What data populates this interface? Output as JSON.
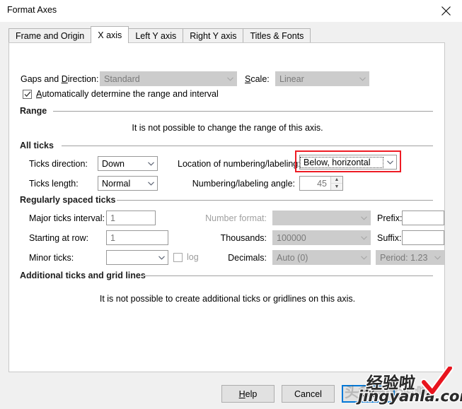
{
  "window": {
    "title": "Format Axes",
    "close_icon": "close-icon"
  },
  "tabs": [
    {
      "label": "Frame and Origin",
      "active": false
    },
    {
      "label": "X axis",
      "active": true
    },
    {
      "label": "Left Y axis",
      "active": false
    },
    {
      "label": "Right Y axis",
      "active": false
    },
    {
      "label": "Titles & Fonts",
      "active": false
    }
  ],
  "top": {
    "gaps_label": "Gaps and Direction:",
    "gaps_label_pre": "Gaps and ",
    "gaps_label_key": "D",
    "gaps_label_post": "irection:",
    "gaps_value": "Standard",
    "scale_label_pre": "",
    "scale_label_key": "S",
    "scale_label_post": "cale:",
    "scale_value": "Linear",
    "auto_range_checkbox": {
      "checked": true,
      "label_key": "A",
      "label_post": "utomatically determine the range and interval"
    }
  },
  "range_group": {
    "header": "Range",
    "message": "It is not possible to change the range of this axis."
  },
  "all_ticks_group": {
    "header": "All ticks",
    "ticks_direction_label": "Ticks direction:",
    "ticks_direction_value": "Down",
    "ticks_length_label": "Ticks length:",
    "ticks_length_value": "Normal",
    "location_label": "Location of numbering/labeling:",
    "location_value": "Below, horizontal",
    "angle_label": "Numbering/labeling angle:",
    "angle_value": "45"
  },
  "regular_ticks_group": {
    "header": "Regularly spaced ticks",
    "major_interval_label": "Major ticks interval:",
    "major_interval_value": "1",
    "starting_row_label": "Starting at row:",
    "starting_row_value": "1",
    "minor_ticks_label": "Minor ticks:",
    "minor_ticks_value": "",
    "log_checkbox_label": "log",
    "log_checked": false,
    "number_format_label": "Number format:",
    "number_format_value": "",
    "thousands_label": "Thousands:",
    "thousands_value": "100000",
    "decimals_label": "Decimals:",
    "decimals_value": "Auto (0)",
    "period_value": "Period: 1.23",
    "prefix_label": "Prefix:",
    "prefix_value": "",
    "suffix_label": "Suffix:",
    "suffix_value": ""
  },
  "additional_group": {
    "header": "Additional ticks and grid lines",
    "message": "It is not possible to create additional ticks or gridlines on this axis."
  },
  "buttons": {
    "help_key": "H",
    "help_post": "elp",
    "help_label": "Help",
    "cancel_label": "Cancel",
    "ok_label": "OK"
  },
  "annotation": {
    "color": "#ee1c25",
    "target": "location-of-numbering-combo"
  },
  "watermark": {
    "faint_text": "头条号·经验啦",
    "cn_text": "经验啦",
    "en_text": "jingyanla.com",
    "check_icon": "red-check-icon"
  },
  "colors": {
    "dialog_bg": "#f0f0f0",
    "panel_bg": "#ffffff",
    "disabled_field": "#cccccc",
    "accent": "#0078d7",
    "annotation_red": "#ee1c25"
  }
}
